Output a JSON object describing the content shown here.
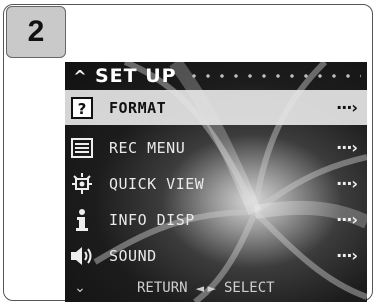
{
  "step": {
    "number": "2"
  },
  "menu": {
    "title": "SET UP",
    "items": [
      {
        "label": "FORMAT",
        "icon": "question-icon",
        "selected": true,
        "chevron": "···›"
      },
      {
        "label": "REC MENU",
        "icon": "rec-menu-icon",
        "selected": false,
        "chevron": "···›"
      },
      {
        "label": "QUICK VIEW",
        "icon": "quick-view-icon",
        "selected": false,
        "chevron": "···›"
      },
      {
        "label": "INFO DISP",
        "icon": "info-icon",
        "selected": false,
        "chevron": "···›"
      },
      {
        "label": "SOUND",
        "icon": "speaker-icon",
        "selected": false,
        "chevron": "···›"
      }
    ],
    "footer": {
      "return_label": "RETURN",
      "select_label": "SELECT"
    }
  }
}
